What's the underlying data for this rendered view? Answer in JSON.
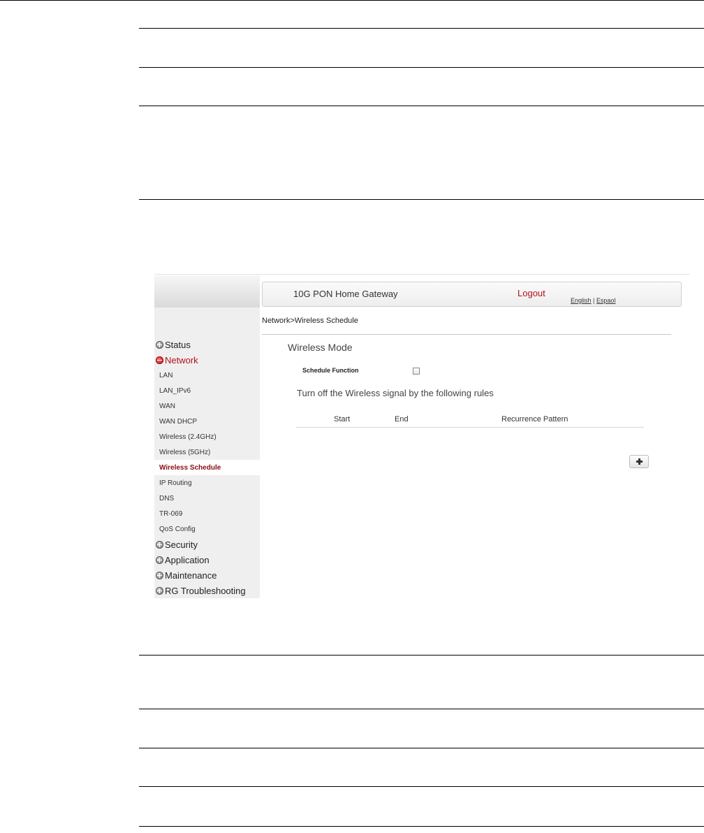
{
  "header": {
    "title": "10G PON Home Gateway",
    "logout": "Logout",
    "lang_english": "English",
    "lang_separator": "|",
    "lang_spanish": "Espaol"
  },
  "breadcrumb": "Network>Wireless Schedule",
  "sidebar": {
    "status": "Status",
    "network": "Network",
    "network_items": [
      "LAN",
      "LAN_IPv6",
      "WAN",
      "WAN DHCP",
      "Wireless (2.4GHz)",
      "Wireless (5GHz)",
      "Wireless Schedule",
      "IP Routing",
      "DNS",
      "TR-069",
      "QoS Config"
    ],
    "security": "Security",
    "application": "Application",
    "maintenance": "Maintenance",
    "rg_troubleshooting": "RG Troubleshooting"
  },
  "main": {
    "section_title": "Wireless Mode",
    "schedule_function_label": "Schedule Function",
    "schedule_function_checked": false,
    "rules_text": "Turn off the Wireless signal by the following rules",
    "columns": [
      "Start",
      "End",
      "Recurrence Pattern"
    ]
  },
  "colors": {
    "accent_red": "#b0121b",
    "active_item_text": "#8b0d14",
    "sidebar_bg": "#efefef"
  }
}
